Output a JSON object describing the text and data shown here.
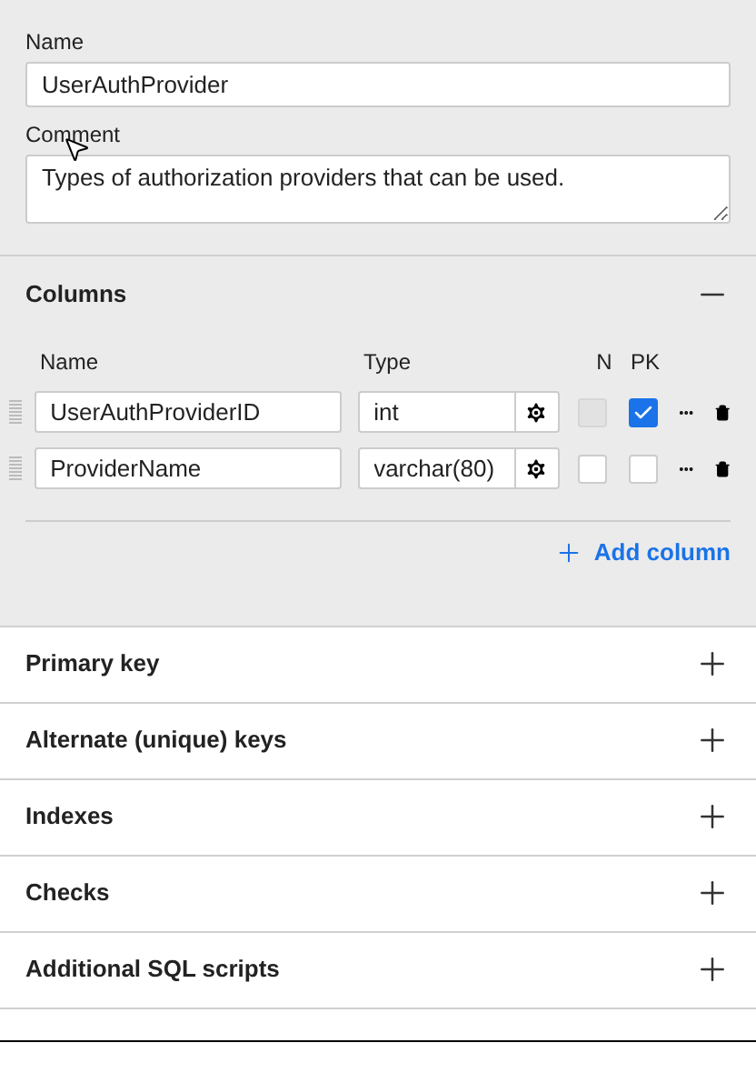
{
  "name_field": {
    "label": "Name",
    "value": "UserAuthProvider"
  },
  "comment_field": {
    "label": "Comment",
    "value": "Types of authorization providers that can be used."
  },
  "columns_section": {
    "title": "Columns",
    "expanded": true,
    "headers": [
      "Name",
      "Type",
      "N",
      "PK"
    ],
    "rows": [
      {
        "name": "UserAuthProviderID",
        "type": "int",
        "nullable": false,
        "nullable_disabled": true,
        "pk": true
      },
      {
        "name": "ProviderName",
        "type": "varchar(80)",
        "nullable": false,
        "nullable_disabled": false,
        "pk": false
      }
    ],
    "add_button": "Add column"
  },
  "sections": [
    {
      "title": "Primary key",
      "expanded": false
    },
    {
      "title": "Alternate (unique) keys",
      "expanded": false
    },
    {
      "title": "Indexes",
      "expanded": false
    },
    {
      "title": "Checks",
      "expanded": false
    },
    {
      "title": "Additional SQL scripts",
      "expanded": false
    }
  ]
}
